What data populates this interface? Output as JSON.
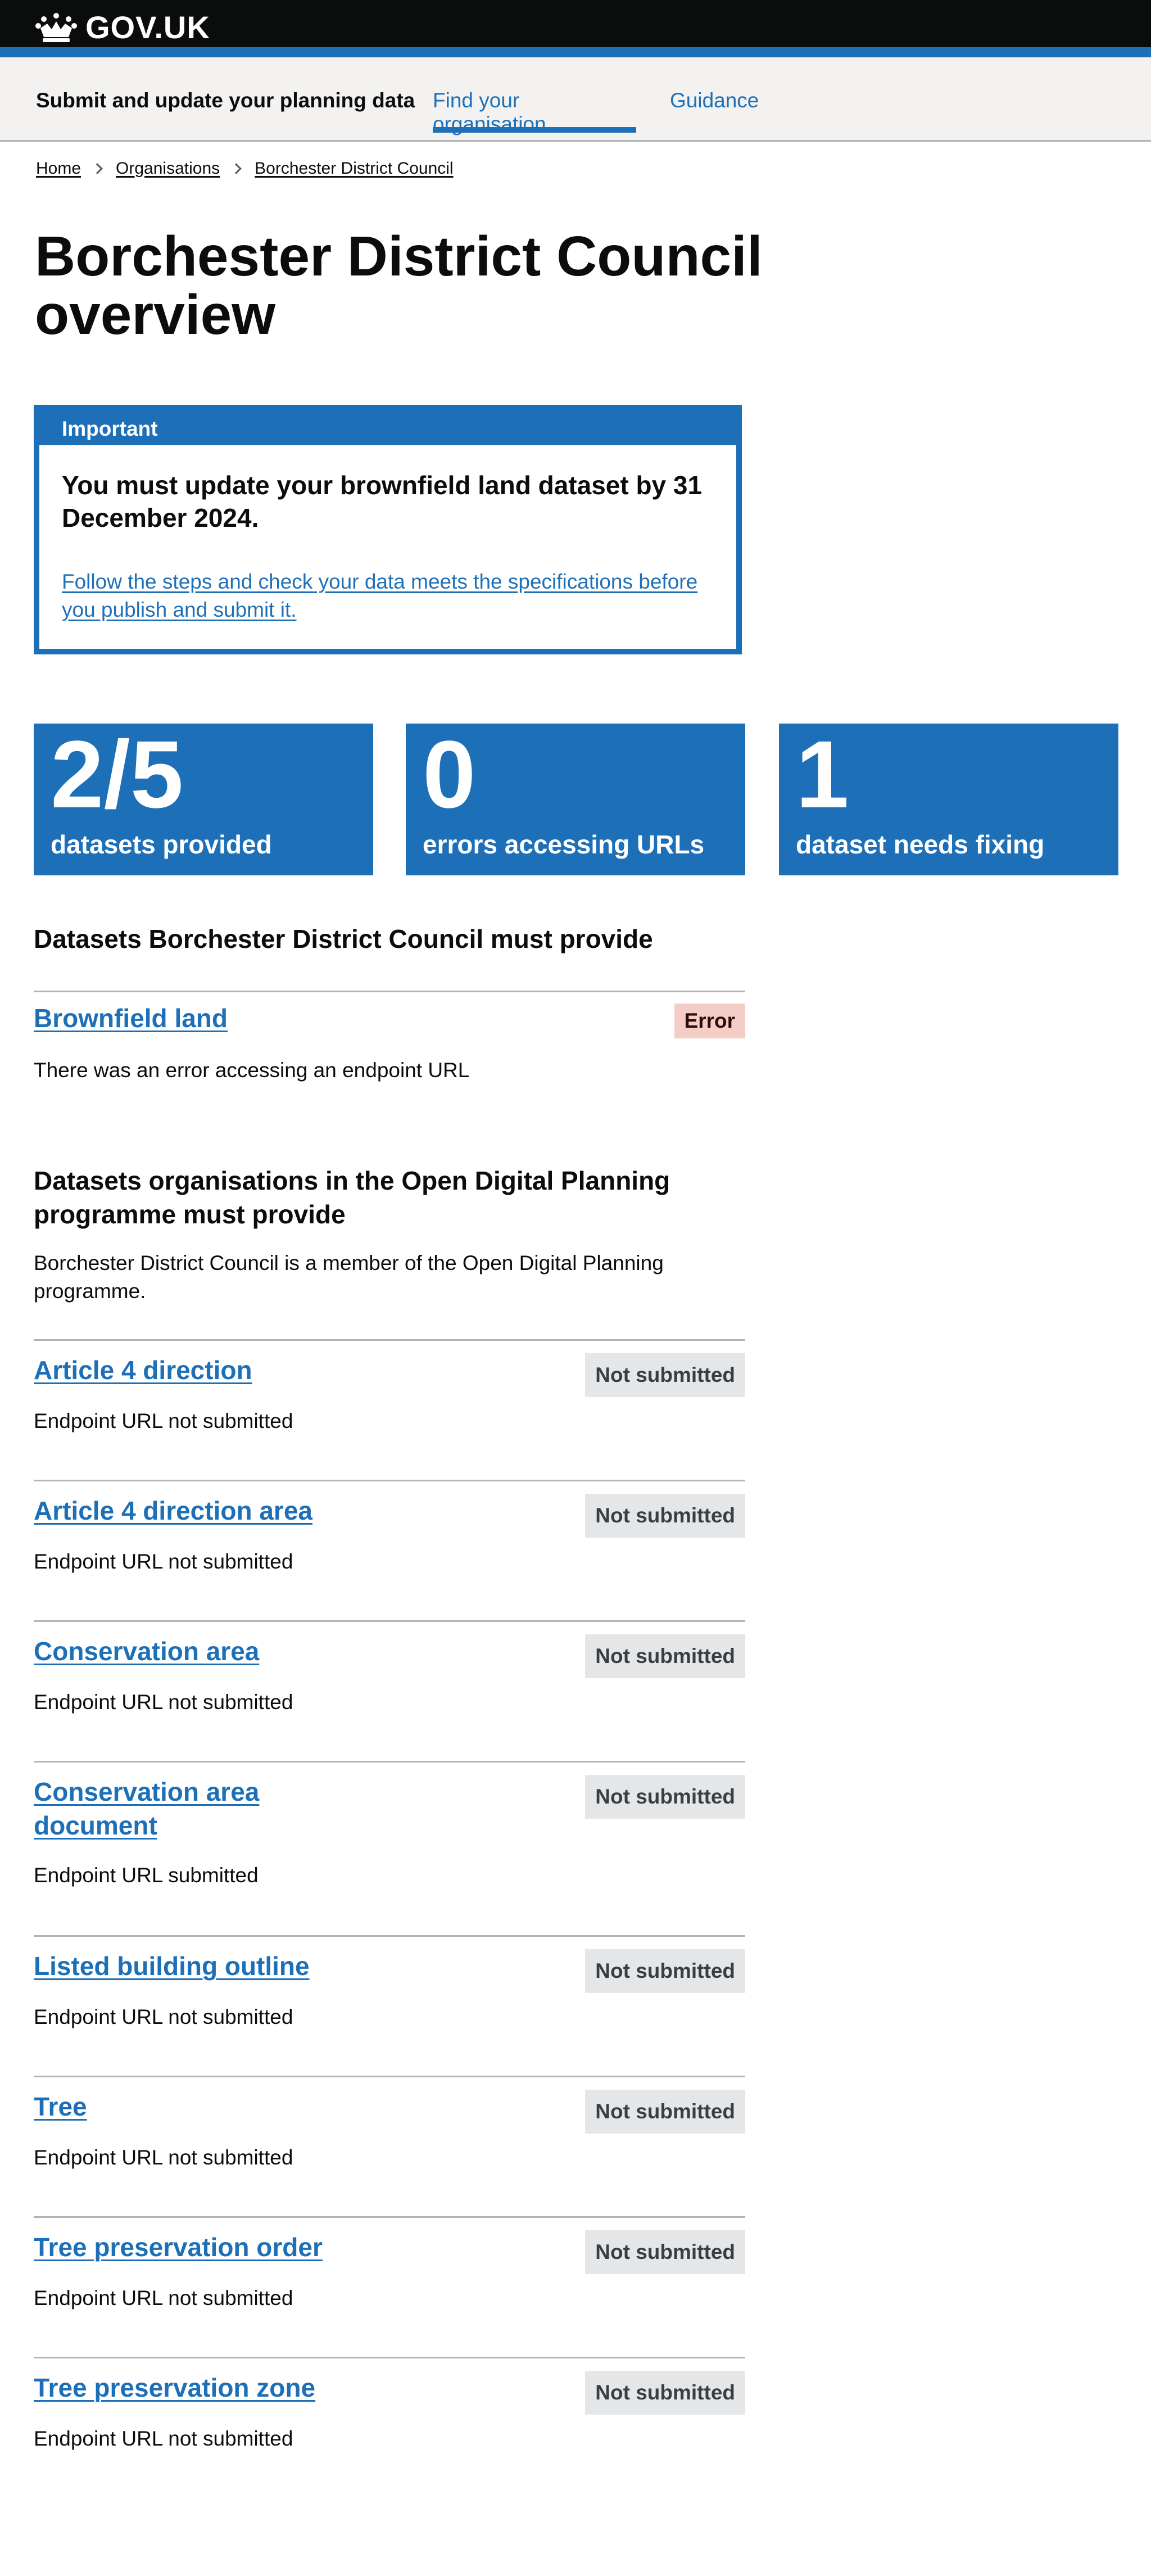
{
  "header": {
    "logotype": "GOV.UK"
  },
  "service_nav": {
    "service_name": "Submit and update your planning data",
    "items": [
      {
        "label": "Find your organisation",
        "active": true
      },
      {
        "label": "Guidance",
        "active": false
      }
    ]
  },
  "breadcrumb": [
    "Home",
    "Organisations",
    "Borchester District Council"
  ],
  "page_title": "Borchester District Council overview",
  "banner": {
    "title": "Important",
    "heading": "You must update your brownfield land dataset by 31 December 2024.",
    "link": "Follow the steps and check your data meets the specifications before you publish and submit it."
  },
  "stats": [
    {
      "number": "2/5",
      "label": "datasets provided"
    },
    {
      "number": "0",
      "label": "errors accessing URLs"
    },
    {
      "number": "1",
      "label": "dataset needs fixing"
    }
  ],
  "required_section": {
    "heading": "Datasets Borchester District Council must provide",
    "datasets": [
      {
        "name": "Brownfield land",
        "status": "Error",
        "description": "There was an error accessing an endpoint URL"
      }
    ]
  },
  "odp_section": {
    "heading": "Datasets organisations in the Open Digital Planning programme must provide",
    "intro": "Borchester District Council is a member of the Open Digital Planning programme.",
    "datasets": [
      {
        "name": "Article 4 direction",
        "status": "Not submitted",
        "description": "Endpoint URL not submitted"
      },
      {
        "name": "Article 4 direction area",
        "status": "Not submitted",
        "description": "Endpoint URL not submitted"
      },
      {
        "name": "Conservation area",
        "status": "Not submitted",
        "description": "Endpoint URL not submitted"
      },
      {
        "name": "Conservation area document",
        "status": "Not submitted",
        "description": "Endpoint URL submitted"
      },
      {
        "name": "Listed building outline",
        "status": "Not submitted",
        "description": "Endpoint URL not submitted"
      },
      {
        "name": "Tree",
        "status": "Not submitted",
        "description": "Endpoint URL not submitted"
      },
      {
        "name": "Tree preservation order",
        "status": "Not submitted",
        "description": "Endpoint URL not submitted"
      },
      {
        "name": "Tree preservation zone",
        "status": "Not submitted",
        "description": "Endpoint URL not submitted"
      }
    ]
  },
  "colors": {
    "brand_blue": "#1d70b8",
    "header_black": "#0b0c0c",
    "error_tag": "#f4cdc6",
    "grey_tag": "#e5e6e7"
  }
}
